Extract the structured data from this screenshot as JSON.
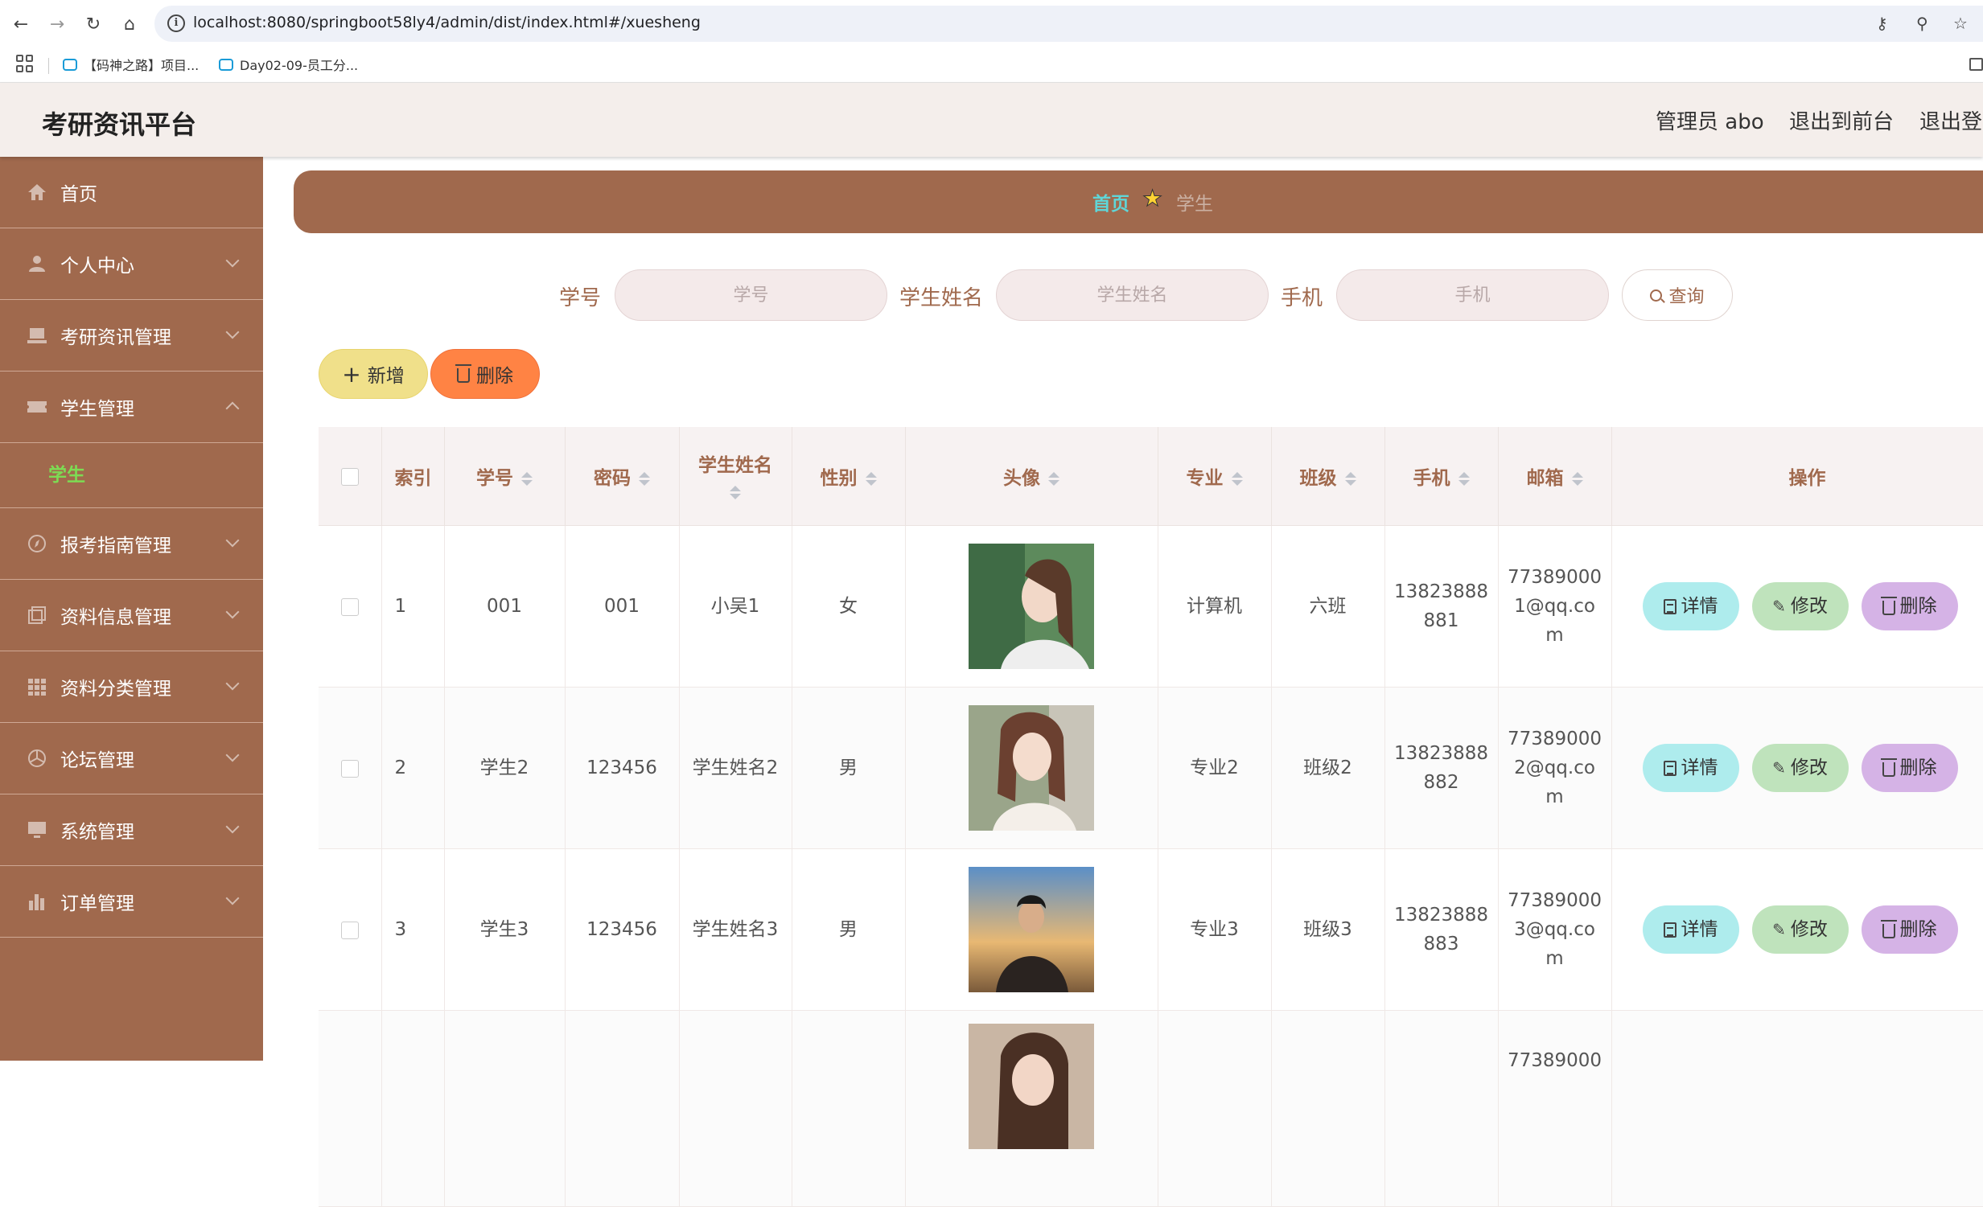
{
  "browser": {
    "url": "localhost:8080/springboot58ly4/admin/dist/index.html#/xuesheng",
    "bookmarks": [
      {
        "label": "【码神之路】项目..."
      },
      {
        "label": "Day02-09-员工分..."
      }
    ]
  },
  "header": {
    "title": "考研资讯平台",
    "user": "管理员 abo",
    "to_front": "退出到前台",
    "logout": "退出登录"
  },
  "sidebar": {
    "items": [
      {
        "label": "首页",
        "icon": "home-icon"
      },
      {
        "label": "个人中心",
        "icon": "user-icon"
      },
      {
        "label": "考研资讯管理",
        "icon": "laptop-icon"
      },
      {
        "label": "学生管理",
        "icon": "ticket-icon",
        "expanded": true,
        "sub": "学生"
      },
      {
        "label": "报考指南管理",
        "icon": "compass-icon"
      },
      {
        "label": "资料信息管理",
        "icon": "copy-icon"
      },
      {
        "label": "资料分类管理",
        "icon": "grid-icon"
      },
      {
        "label": "论坛管理",
        "icon": "aperture-icon"
      },
      {
        "label": "系统管理",
        "icon": "monitor-icon"
      },
      {
        "label": "订单管理",
        "icon": "bar-chart-icon"
      }
    ]
  },
  "breadcrumb": {
    "home": "首页",
    "current": "学生"
  },
  "search": {
    "fields": [
      {
        "label": "学号",
        "placeholder": "学号"
      },
      {
        "label": "学生姓名",
        "placeholder": "学生姓名"
      },
      {
        "label": "手机",
        "placeholder": "手机"
      }
    ],
    "button": "查询"
  },
  "actions": {
    "add": "新增",
    "delete": "删除"
  },
  "table": {
    "columns": [
      "索引",
      "学号",
      "密码",
      "学生姓名",
      "性别",
      "头像",
      "专业",
      "班级",
      "手机",
      "邮箱",
      "操作"
    ],
    "rows": [
      {
        "index": "1",
        "xuehao": "001",
        "mima": "001",
        "name": "小吴1",
        "gender": "女",
        "major": "计算机",
        "class": "六班",
        "phone_a": "13823888",
        "phone_b": "881",
        "email_a": "77389000",
        "email_b": "1@qq.co",
        "email_c": "m"
      },
      {
        "index": "2",
        "xuehao": "学生2",
        "mima": "123456",
        "name": "学生姓名2",
        "gender": "男",
        "major": "专业2",
        "class": "班级2",
        "phone_a": "13823888",
        "phone_b": "882",
        "email_a": "77389000",
        "email_b": "2@qq.co",
        "email_c": "m"
      },
      {
        "index": "3",
        "xuehao": "学生3",
        "mima": "123456",
        "name": "学生姓名3",
        "gender": "男",
        "major": "专业3",
        "class": "班级3",
        "phone_a": "13823888",
        "phone_b": "883",
        "email_a": "77389000",
        "email_b": "3@qq.co",
        "email_c": "m"
      },
      {
        "index": "",
        "xuehao": "",
        "mima": "",
        "name": "",
        "gender": "",
        "major": "",
        "class": "",
        "phone_a": "",
        "phone_b": "",
        "email_a": "77389000",
        "email_b": "",
        "email_c": ""
      }
    ],
    "ops": {
      "detail": "详情",
      "edit": "修改",
      "delete": "删除"
    }
  },
  "colors": {
    "brand": "#a0694d",
    "header_bg": "#f4eeeb",
    "active_sub": "#7ddb53",
    "crumb_home": "#5fd6d8"
  }
}
